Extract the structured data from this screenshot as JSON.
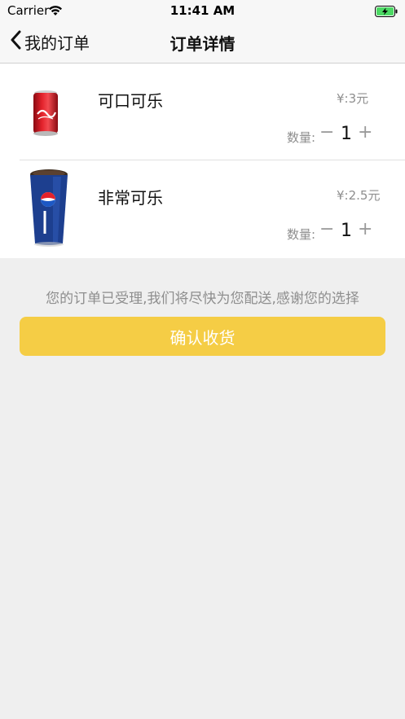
{
  "status_bar": {
    "carrier": "Carrier",
    "time": "11:41 AM"
  },
  "nav": {
    "back_label": "我的订单",
    "title": "订单详情"
  },
  "orders": [
    {
      "name": "可口可乐",
      "price": "¥:3元",
      "qty_label": "数量:",
      "minus": "−",
      "qty": "1",
      "plus": "+",
      "image": "coca-cola-can"
    },
    {
      "name": "非常可乐",
      "price": "¥:2.5元",
      "qty_label": "数量:",
      "minus": "−",
      "qty": "1",
      "plus": "+",
      "image": "pepsi-cup"
    }
  ],
  "message": "您的订单已受理,我们将尽快为您配送,感谢您的选择",
  "confirm_label": "确认收货",
  "colors": {
    "accent": "#f5cd45",
    "muted_text": "#8e8e8e",
    "background": "#efefef"
  }
}
